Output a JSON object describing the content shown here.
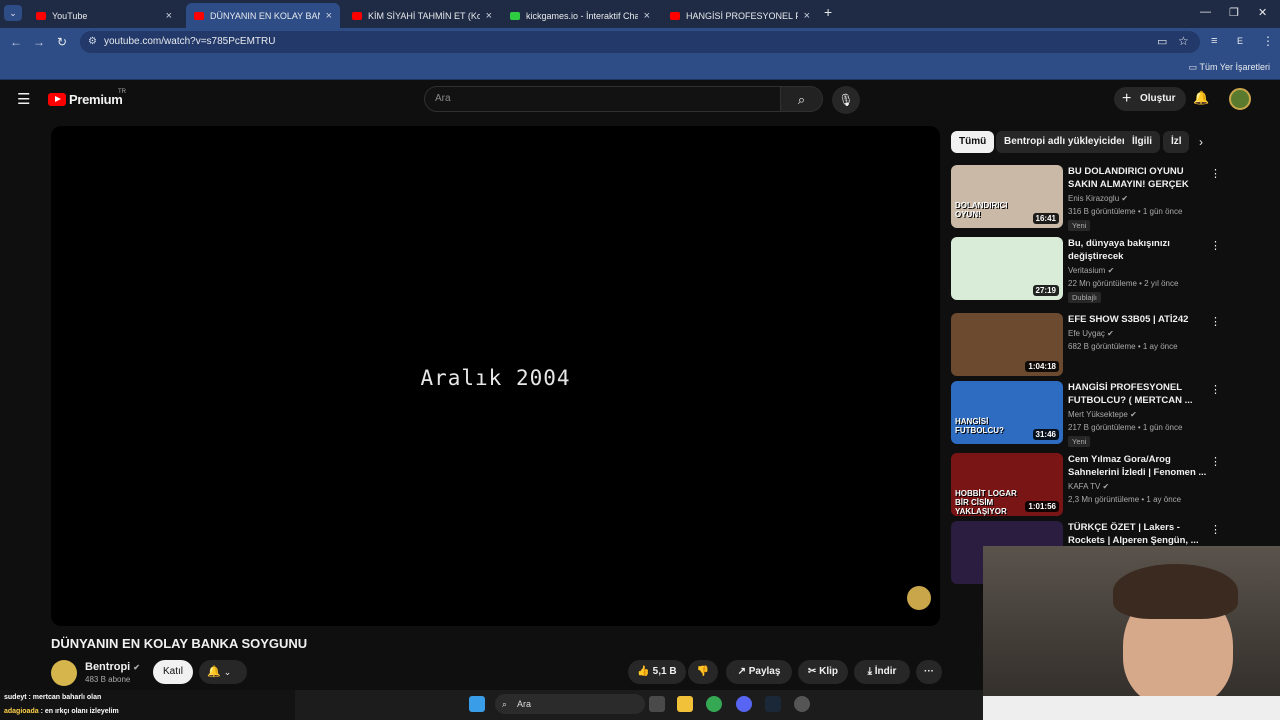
{
  "browser": {
    "tabs": [
      {
        "title": "YouTube",
        "active": false
      },
      {
        "title": "DÜNYANIN EN KOLAY BANKA S",
        "active": true
      },
      {
        "title": "KİM SİYAHİ TAHMİN ET (Konuk",
        "active": false
      },
      {
        "title": "kickgames.io - İnteraktif Chat O",
        "active": false
      },
      {
        "title": "HANGİSİ PROFESYONEL FUTBO",
        "active": false
      }
    ],
    "url": "youtube.com/watch?v=s785PcEMTRU",
    "bookmarks_all": "Tüm Yer İşaretleri",
    "profile_letter": "E"
  },
  "youtube": {
    "logo_text": "Premium",
    "region": "TR",
    "search_placeholder": "Ara",
    "create_label": "Oluştur"
  },
  "video": {
    "frame_text": "Aralık 2004",
    "title": "DÜNYANIN EN KOLAY BANKA SOYGUNU",
    "channel": "Bentropi",
    "subscribers": "483 B abone",
    "join_label": "Katıl",
    "likes": "5,1 B",
    "share_label": "Paylaş",
    "clip_label": "Klip",
    "download_label": "İndir",
    "more_label": "···"
  },
  "chips": [
    "Tümü",
    "Bentropi adlı yükleyiciden",
    "İlgili",
    "İzl"
  ],
  "recommendations": [
    {
      "title": "BU DOLANDIRICI OYUNU SAKIN ALMAYIN! GERÇEK GİBİ ...",
      "channel": "Enis Kirazoglu",
      "meta": "316 B görüntüleme • 1 gün önce",
      "badge": "Yeni",
      "duration": "16:41",
      "thumb_color": "#c9b9a6",
      "thumb_text": "DOLANDIRICI OYUN!"
    },
    {
      "title": "Bu, dünyaya bakışınızı değiştirecek",
      "channel": "Veritasium",
      "meta": "22 Mn görüntüleme • 2 yıl önce",
      "badge": "Dublajlı",
      "duration": "27:19",
      "thumb_color": "#d9ecd8",
      "thumb_text": ""
    },
    {
      "title": "EFE SHOW S3B05 | ATİ242",
      "channel": "Efe Uygaç",
      "meta": "682 B görüntüleme • 1 ay önce",
      "badge": "",
      "duration": "1:04:18",
      "thumb_color": "#6b4a2f",
      "thumb_text": ""
    },
    {
      "title": "HANGİSİ PROFESYONEL FUTBOLCU? ( MERTCAN ...",
      "channel": "Mert Yüksektepe",
      "meta": "217 B görüntüleme • 1 gün önce",
      "badge": "Yeni",
      "duration": "31:46",
      "thumb_color": "#2d6cc0",
      "thumb_text": "HANGİSİ FUTBOLCU?"
    },
    {
      "title": "Cem Yılmaz Gora/Arog Sahnelerini İzledi | Fenomen ...",
      "channel": "KAFA TV",
      "meta": "2,3 Mn görüntüleme • 1 ay önce",
      "badge": "",
      "duration": "1:01:56",
      "thumb_color": "#7a1515",
      "thumb_text": "HOBBİT LOGAR BİR CİSİM YAKLAŞIYOR"
    },
    {
      "title": "TÜRKÇE ÖZET | Lakers - Rockets | Alperen Şengün, ...",
      "channel": "",
      "meta": "",
      "badge": "",
      "duration": "",
      "thumb_color": "#2b1d3f",
      "thumb_text": ""
    }
  ],
  "chat": [
    {
      "user": "sudeyt",
      "message": "mertcan baharlı olan",
      "color": "#ffffff"
    },
    {
      "user": "adagioada",
      "message": "en ırkçı olanı izleyelim",
      "color": "#ffd24a"
    }
  ],
  "taskbar": {
    "search_placeholder": "Ara"
  }
}
